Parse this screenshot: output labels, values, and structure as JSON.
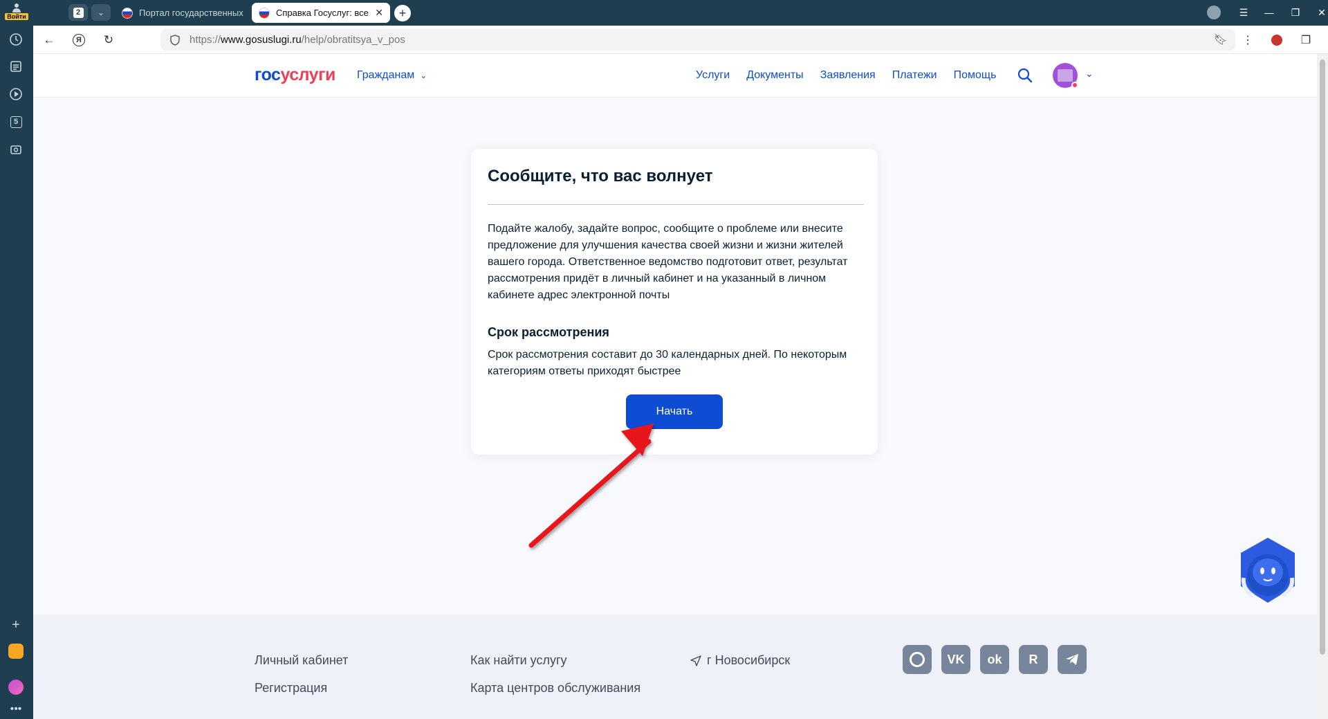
{
  "browser": {
    "login_label": "Войти",
    "tab_count": "2",
    "tabs": [
      {
        "title": "Портал государственных"
      },
      {
        "title": "Справка Госуслуг: все"
      }
    ],
    "url": {
      "prefix": "https://",
      "host": "www.gosuslugi.ru",
      "path": "/help/obratitsya_v_pos"
    },
    "sidebar_badge": "5"
  },
  "header": {
    "logo_part1": "гос",
    "logo_part2": "услуги",
    "audience": "Гражданам",
    "nav": [
      {
        "label": "Услуги"
      },
      {
        "label": "Документы"
      },
      {
        "label": "Заявления"
      },
      {
        "label": "Платежи"
      },
      {
        "label": "Помощь"
      }
    ]
  },
  "card": {
    "title": "Сообщите, что вас волнует",
    "description": "Подайте жалобу, задайте вопрос, сообщите о проблеме или внесите предложение для улучшения качества своей жизни и жизни жителей вашего города. Ответственное ведомство подготовит ответ, результат рассмотрения придёт в личный кабинет и на указанный в личном кабинете адрес электронной почты",
    "subtitle": "Срок рассмотрения",
    "subdescription": "Срок рассмотрения составит до 30 календарных дней. По некоторым категориям ответы приходят быстрее",
    "button": "Начать"
  },
  "footer": {
    "col1": [
      "Личный кабинет",
      "Регистрация"
    ],
    "col2": [
      "Как найти услугу",
      "Карта центров обслуживания"
    ],
    "city": "г Новосибирск"
  },
  "colors": {
    "brand_blue": "#0d4cd3",
    "brand_red": "#ee3f58",
    "annotation_arrow": "#e8131b"
  }
}
